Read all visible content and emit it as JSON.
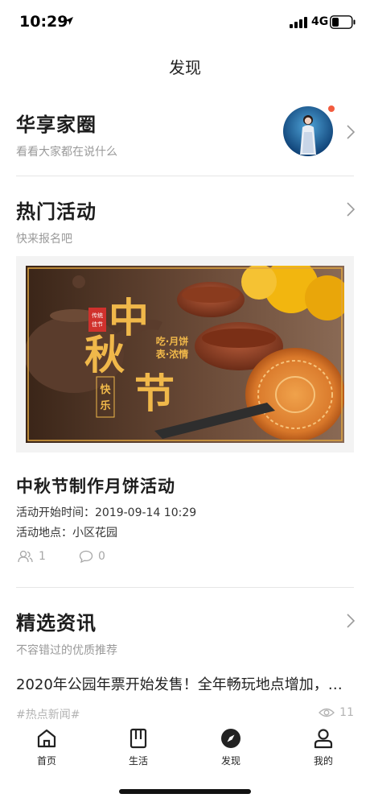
{
  "status_bar": {
    "time": "10:29",
    "network": "4G"
  },
  "nav": {
    "title": "发现"
  },
  "community": {
    "title": "华享家圈",
    "subtitle": "看看大家都在说什么"
  },
  "activities": {
    "title": "热门活动",
    "subtitle": "快来报名吧",
    "banner": {
      "big1": "中",
      "big2": "秋",
      "big3": "节",
      "seal": "传统\n佳节",
      "line1": "吃·月饼",
      "line2": "表·浓情",
      "joy": "快乐"
    },
    "event": {
      "title": "中秋节制作月饼活动",
      "time_label": "活动开始时间：",
      "time_value": "2019-09-14 10:29",
      "place_label": "活动地点：",
      "place_value": "小区花园",
      "participants": "1",
      "comments": "0"
    }
  },
  "news": {
    "title": "精选资讯",
    "subtitle": "不容错过的优质推荐",
    "item": {
      "headline": "2020年公园年票开始发售！全年畅玩地点增加，…",
      "tag": "#热点新闻#",
      "views": "11"
    }
  },
  "tabs": [
    {
      "label": "首页",
      "icon": "home-icon"
    },
    {
      "label": "生活",
      "icon": "life-icon"
    },
    {
      "label": "发现",
      "icon": "compass-icon"
    },
    {
      "label": "我的",
      "icon": "person-icon"
    }
  ],
  "colors": {
    "notification_dot": "#f25b3e",
    "banner_gold": "#e9a33b",
    "muted_text": "#9a9a9a"
  }
}
